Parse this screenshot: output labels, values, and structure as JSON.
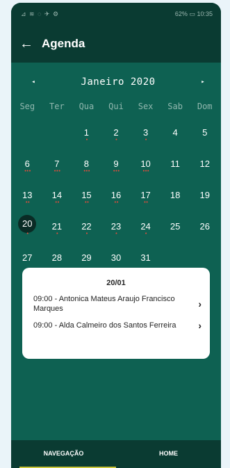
{
  "status_bar": {
    "left_icons": "⊿ ≋ ◌ ✈ ⚙",
    "battery": "62%",
    "time": "10:35"
  },
  "app_bar": {
    "back_icon": "arrow-left-icon",
    "title": "Agenda"
  },
  "calendar": {
    "prev_icon": "◂",
    "next_icon": "▸",
    "month_label": "Janeiro 2020",
    "weekdays": [
      "Seg",
      "Ter",
      "Qua",
      "Qui",
      "Sex",
      "Sab",
      "Dom"
    ],
    "selected_day": "20",
    "weeks": [
      [
        {
          "d": ""
        },
        {
          "d": ""
        },
        {
          "d": "1",
          "dots": "•"
        },
        {
          "d": "2",
          "dots": "•"
        },
        {
          "d": "3",
          "dots": "•"
        },
        {
          "d": "4"
        },
        {
          "d": "5"
        }
      ],
      [
        {
          "d": "6",
          "dots": "•••"
        },
        {
          "d": "7",
          "dots": "•••"
        },
        {
          "d": "8",
          "dots": "•••"
        },
        {
          "d": "9",
          "dots": "•••"
        },
        {
          "d": "10",
          "dots": "•••"
        },
        {
          "d": "11"
        },
        {
          "d": "12"
        }
      ],
      [
        {
          "d": "13",
          "dots": "••"
        },
        {
          "d": "14",
          "dots": "••"
        },
        {
          "d": "15",
          "dots": "••"
        },
        {
          "d": "16",
          "dots": "••"
        },
        {
          "d": "17",
          "dots": "••"
        },
        {
          "d": "18"
        },
        {
          "d": "19"
        }
      ],
      [
        {
          "d": "20",
          "dots": "•"
        },
        {
          "d": "21",
          "dots": "•"
        },
        {
          "d": "22",
          "dots": "•"
        },
        {
          "d": "23",
          "dots": "•"
        },
        {
          "d": "24",
          "dots": "•"
        },
        {
          "d": "25"
        },
        {
          "d": "26"
        }
      ],
      [
        {
          "d": "27"
        },
        {
          "d": "28"
        },
        {
          "d": "29"
        },
        {
          "d": "30"
        },
        {
          "d": "31"
        },
        {
          "d": ""
        },
        {
          "d": ""
        }
      ]
    ]
  },
  "day_card": {
    "date": "20/01",
    "appointments": [
      {
        "text": "09:00 - Antonica Mateus Araujo Francisco Marques"
      },
      {
        "text": "09:00 - Alda Calmeiro dos Santos Ferreira"
      }
    ]
  },
  "bottom_nav": {
    "tabs": [
      {
        "label": "NAVEGAÇÃO"
      },
      {
        "label": "HOME"
      }
    ],
    "active": 0
  },
  "colors": {
    "primary": "#0e6152",
    "dark": "#0a3b32",
    "accent": "#c9c63a",
    "dot": "#e74c3c"
  }
}
